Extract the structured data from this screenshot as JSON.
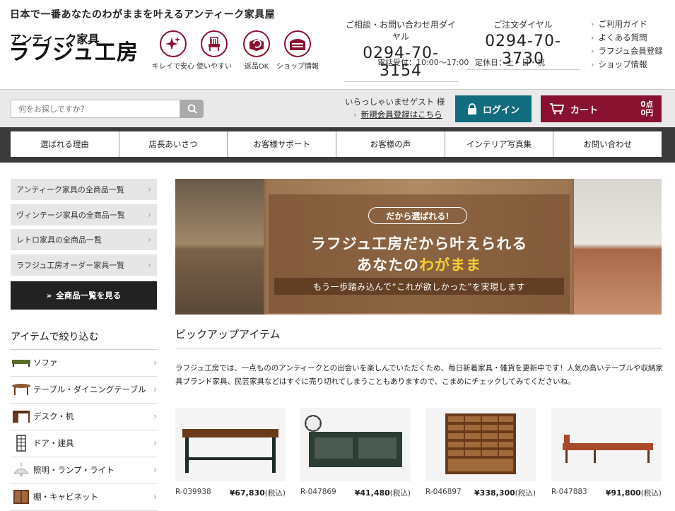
{
  "header": {
    "tagline": "日本で一番あなたのわがままを叶えるアンティーク家具屋",
    "logo_top": "アンティーク家具",
    "logo_main": "ラフジュ工房",
    "features": [
      {
        "label": "キレイで安心",
        "icon": "sparkle-icon"
      },
      {
        "label": "使いやすい",
        "icon": "chair-icon"
      },
      {
        "label": "返品OK",
        "icon": "return-box-icon"
      },
      {
        "label": "ショップ情報",
        "icon": "shop-icon"
      }
    ],
    "phone1_title": "ご相談・お問い合わせ用ダイヤル",
    "phone1_number": "0294-70-3154",
    "phone2_title": "ご注文ダイヤル",
    "phone2_number": "0294-70-3730",
    "hours": "電話受付：10:00～17:00",
    "closed": "定休日：土・日・祝",
    "links": [
      "ご利用ガイド",
      "よくある質問",
      "ラフジュ会員登録",
      "ショップ情報"
    ]
  },
  "toolbar": {
    "search_placeholder": "何をお探しですか？",
    "welcome": "いらっしゃいませゲスト 様",
    "register": "新規会員登録はこちら",
    "login": "ログイン",
    "cart": "カート",
    "cart_points": "0点",
    "cart_yen": "0円"
  },
  "nav": [
    "選ばれる理由",
    "店長あいさつ",
    "お客様サポート",
    "お客様の声",
    "インテリア写真集",
    "お問い合わせ"
  ],
  "sidebar": {
    "categories": [
      "アンティーク家具の全商品一覧",
      "ヴィンテージ家具の全商品一覧",
      "レトロ家具の全商品一覧",
      "ラフジュ工房オーダー家具一覧"
    ],
    "all_button": "全商品一覧を見る",
    "filter_title": "アイテムで絞り込む",
    "filters": [
      "ソファ",
      "テーブル・ダイニングテーブル",
      "デスク・机",
      "ドア・建具",
      "照明・ランプ・ライト",
      "棚・キャビネット"
    ]
  },
  "hero": {
    "badge": "だから選ばれる!",
    "line1": "ラフジュ工房だから叶えられる",
    "line2_prefix": "あなたの",
    "line2_highlight": "わがまま",
    "line3": "もう一歩踏み込んで“これが欲しかった”を実現します"
  },
  "pickup": {
    "title": "ピックアップアイテム",
    "description": "ラフジュ工房では、一点もののアンティークとの出会いを楽しんでいただくため、毎日新着家具・雑貨を更新中です！人気の高いテーブルや収納家具ブランド家具、民芸家具などはすぐに売り切れてしまうこともありますので、こまめにチェックしてみてくださいね。",
    "products": [
      {
        "code": "R-039938",
        "price": "¥67,830",
        "tax": "(税込)"
      },
      {
        "code": "R-047869",
        "price": "¥41,480",
        "tax": "(税込)"
      },
      {
        "code": "R-046897",
        "price": "¥338,300",
        "tax": "(税込)"
      },
      {
        "code": "R-047883",
        "price": "¥91,800",
        "tax": "(税込)"
      }
    ]
  },
  "colors": {
    "brand": "#8a1030",
    "login": "#116c7d",
    "nav": "#3a3a3a",
    "highlight": "#f5d12e"
  }
}
